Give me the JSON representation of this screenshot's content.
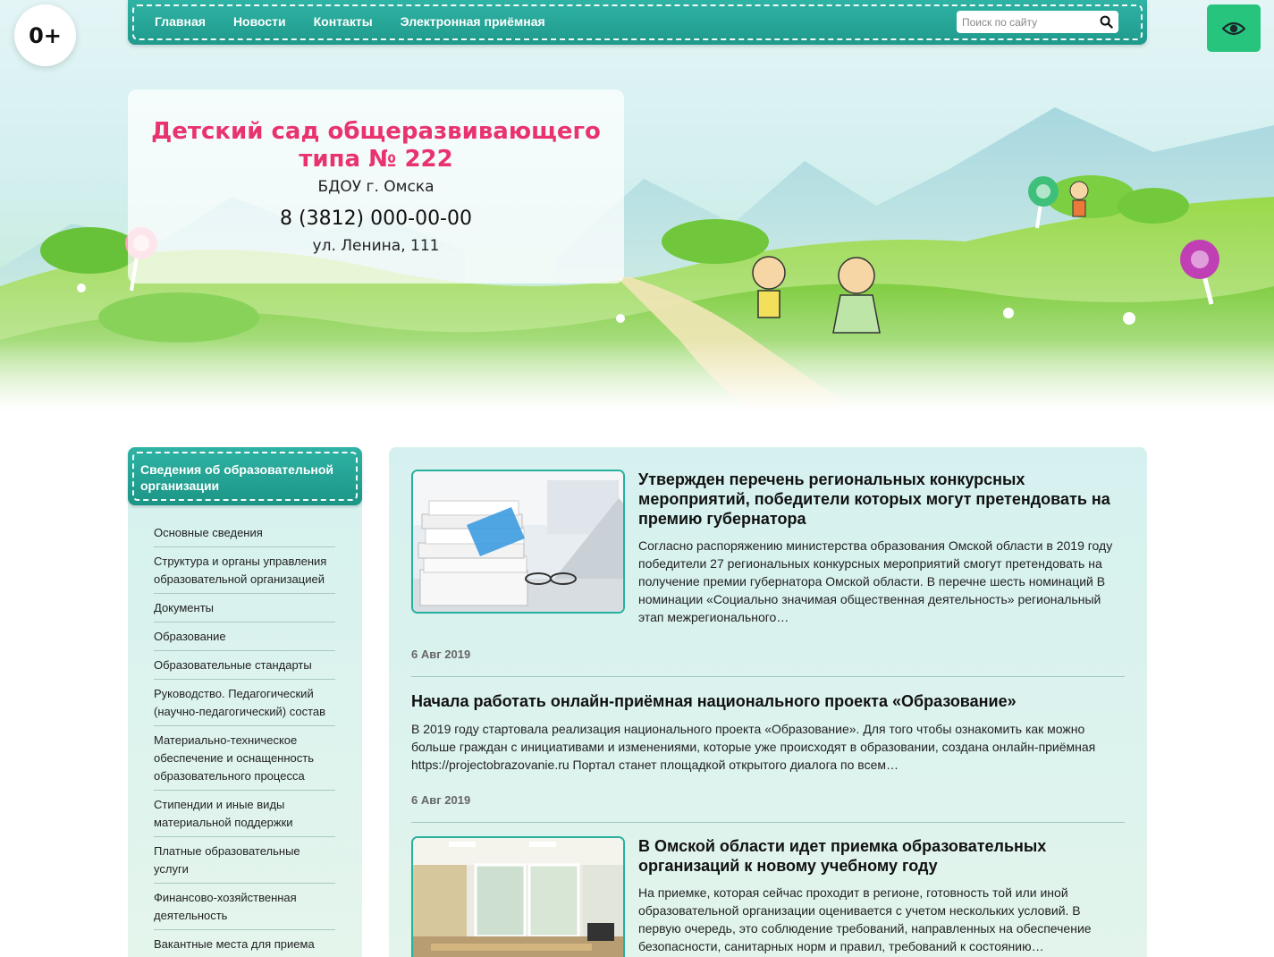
{
  "age_rating": "0+",
  "nav": {
    "items": [
      "Главная",
      "Новости",
      "Контакты",
      "Электронная приёмная"
    ],
    "search_placeholder": "Поиск по сайту"
  },
  "org": {
    "title": "Детский сад общеразвивающего типа № 222",
    "subtitle": "БДОУ г. Омска",
    "phone": "8 (3812) 000-00-00",
    "address": "ул. Ленина, 111"
  },
  "sidebar": {
    "title": "Сведения об образовательной организации",
    "items": [
      "Основные сведения",
      "Структура и органы управления образовательной организацией",
      "Документы",
      "Образование",
      "Образовательные стандарты",
      "Руководство. Педагогический (научно-педагогический) состав",
      "Материально-техническое обеспечение и оснащенность образовательного процесса",
      "Стипендии и иные виды материальной поддержки",
      "Платные образовательные услуги",
      "Финансово-хозяйственная деятельность",
      "Вакантные места для приема (перевода)"
    ]
  },
  "news": [
    {
      "title": "Утвержден перечень региональных конкурсных мероприятий, победители которых могут претендовать на премию губернатора",
      "text": "Согласно распоряжению министерства образования Омской области в 2019 году победители 27 региональных конкурсных мероприятий смогут претендовать на получение премии губернатора Омской области. В перечне шесть номинаций В номинации «Социально значимая общественная деятельность» региональный этап межрегионального…",
      "date": "6 Авг 2019"
    },
    {
      "title": "Начала работать онлайн-приёмная национального проекта «Образование»",
      "text": "В 2019 году стартовала реализация национального проекта «Образование». Для того чтобы ознакомить как можно больше граждан с инициативами и изменениями, которые уже происходят в образовании, создана онлайн-приёмная https://projectobrazovanie.ru Портал станет площадкой открытого диалога по всем…",
      "date": "6 Авг 2019"
    },
    {
      "title": "В Омской области идет приемка образовательных организаций к новому учебному году",
      "text": "На приемке, которая сейчас проходит в регионе, готовность той или иной образовательной организации оценивается с учетом нескольких условий. В первую очередь, это соблюдение требований, направленных на обеспечение безопасности, санитарных норм и правил, требований к состоянию…"
    }
  ],
  "colors": {
    "teal": "#1f9a8c",
    "pink_title": "#e8336f",
    "eye_button": "#27c47e",
    "panel_bg": "#d5f1ef"
  }
}
